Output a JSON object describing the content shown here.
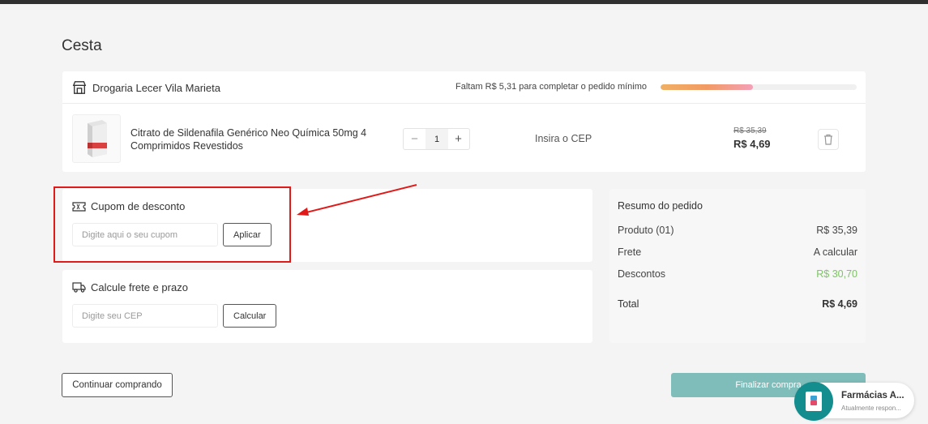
{
  "page": {
    "title": "Cesta"
  },
  "store": {
    "name": "Drogaria Lecer Vila Marieta",
    "min_order_text": "Faltam R$ 5,31 para completar o pedido mínimo",
    "min_order_progress": 0.47
  },
  "product": {
    "name": "Citrato de Sildenafila Genérico Neo Química 50mg 4 Comprimidos Revestidos",
    "quantity": "1",
    "decrease_label": "−",
    "increase_label": "+",
    "cep_link": "Insira o CEP",
    "old_price": "R$ 35,39",
    "new_price": "R$ 4,69"
  },
  "coupon": {
    "title": "Cupom de desconto",
    "placeholder": "Digite aqui o seu cupom",
    "button": "Aplicar"
  },
  "freight": {
    "title": "Calcule frete e prazo",
    "placeholder": "Digite seu CEP",
    "button": "Calcular"
  },
  "summary": {
    "title": "Resumo do pedido",
    "product_label": "Produto (01)",
    "product_value": "R$ 35,39",
    "freight_label": "Frete",
    "freight_value": "A calcular",
    "discount_label": "Descontos",
    "discount_value": "R$ 30,70",
    "total_label": "Total",
    "total_value": "R$ 4,69"
  },
  "actions": {
    "continue": "Continuar comprando",
    "finalize": "Finalizar compra"
  },
  "chat": {
    "name": "Farmácias A...",
    "status": "Atualmente respon..."
  },
  "colors": {
    "highlight": "#e01919",
    "accent": "#7fbdbb",
    "discount": "#7cc463",
    "chat": "#138d8e"
  }
}
